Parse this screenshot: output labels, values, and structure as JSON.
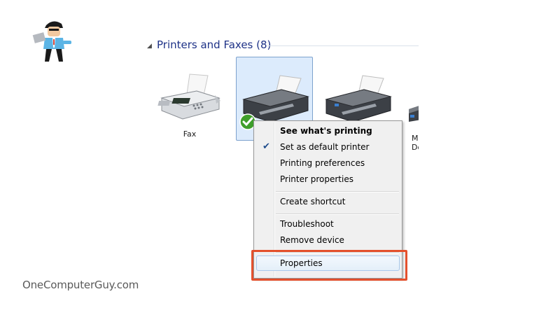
{
  "group": {
    "title": "Printers and Faxes (8)",
    "arrow_icon": "collapse-triangle-icon"
  },
  "devices": [
    {
      "label": "Fax",
      "icon": "fax-machine-icon"
    },
    {
      "label": "",
      "icon": "printer-icon",
      "selected": true,
      "default_badge": "green-checkmark-icon"
    },
    {
      "label": "",
      "icon": "printer-icon"
    },
    {
      "label": "M\nDo",
      "icon": "printer-icon"
    }
  ],
  "context_menu": {
    "items": [
      {
        "label": "See what's printing",
        "bold": true
      },
      {
        "label": "Set as default printer",
        "checked": true
      },
      {
        "label": "Printing preferences"
      },
      {
        "label": "Printer properties"
      },
      {
        "label": "Create shortcut"
      },
      {
        "label": "Troubleshoot"
      },
      {
        "label": "Remove device"
      },
      {
        "label": "Properties",
        "highlighted": true
      }
    ]
  },
  "watermark": "OneComputerGuy.com",
  "colors": {
    "highlight": "#e4502c",
    "selection": "#dcebfc",
    "group_title": "#1e3287"
  }
}
